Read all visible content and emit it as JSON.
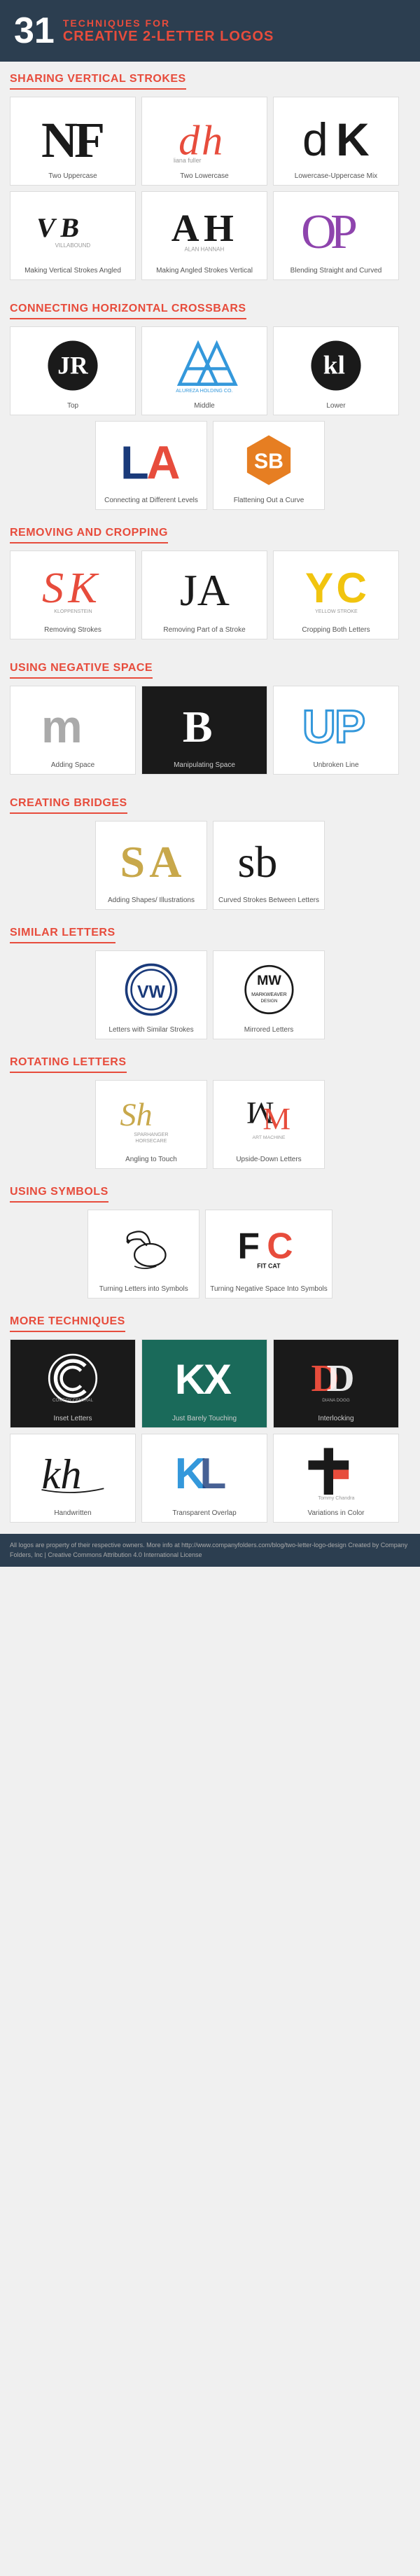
{
  "header": {
    "number": "31",
    "line1_plain": "TECHNIQUES FOR",
    "line1_highlight": "TECHNIQUES FOR",
    "line2": "CREATIVE 2-LETTER LOGOS"
  },
  "sections": [
    {
      "id": "sharing-vertical-strokes",
      "title": "Sharing Vertical Strokes",
      "rows": [
        [
          {
            "label": "Two Uppercase"
          },
          {
            "label": "Two Lowercase"
          },
          {
            "label": "Lowercase-Uppercase Mix"
          }
        ],
        [
          {
            "label": "Making Vertical Strokes Angled"
          },
          {
            "label": "Making Angled Strokes Vertical"
          },
          {
            "label": "Blending Straight and Curved"
          }
        ]
      ]
    },
    {
      "id": "connecting-horizontal-crossbars",
      "title": "Connecting Horizontal Crossbars",
      "rows": [
        [
          {
            "label": "Top"
          },
          {
            "label": "Middle"
          },
          {
            "label": "Lower"
          }
        ],
        [
          {
            "label": "Connecting at Different Levels"
          },
          {
            "label": "Flattening Out a Curve"
          }
        ]
      ]
    },
    {
      "id": "removing-and-cropping",
      "title": "Removing and Cropping",
      "rows": [
        [
          {
            "label": "Removing Strokes"
          },
          {
            "label": "Removing Part of a Stroke"
          },
          {
            "label": "Cropping Both Letters"
          }
        ]
      ]
    },
    {
      "id": "using-negative-space",
      "title": "Using Negative Space",
      "rows": [
        [
          {
            "label": "Adding Space"
          },
          {
            "label": "Manipulating Space"
          },
          {
            "label": "Unbroken Line"
          }
        ]
      ]
    },
    {
      "id": "creating-bridges",
      "title": "Creating Bridges",
      "rows": [
        [
          {
            "label": "Adding Shapes/ Illustrations"
          },
          {
            "label": "Curved Strokes Between Letters"
          }
        ]
      ]
    },
    {
      "id": "similar-letters",
      "title": "Similar Letters",
      "rows": [
        [
          {
            "label": "Letters with Similar Strokes"
          },
          {
            "label": "Mirrored Letters"
          }
        ]
      ]
    },
    {
      "id": "rotating-letters",
      "title": "Rotating Letters",
      "rows": [
        [
          {
            "label": "Angling to Touch"
          },
          {
            "label": "Upside-Down Letters"
          }
        ]
      ]
    },
    {
      "id": "using-symbols",
      "title": "Using Symbols",
      "rows": [
        [
          {
            "label": "Turning Letters into Symbols"
          },
          {
            "label": "Turning Negative Space\nInto Symbols"
          }
        ]
      ]
    },
    {
      "id": "more-techniques",
      "title": "More Techniques",
      "rows": [
        [
          {
            "label": "Inset Letters"
          },
          {
            "label": "Just Barely Touching"
          },
          {
            "label": "Interlocking"
          }
        ],
        [
          {
            "label": "Handwritten"
          },
          {
            "label": "Transparent Overlap"
          },
          {
            "label": "Variations in Color"
          }
        ]
      ]
    }
  ],
  "footer": {
    "text": "All logos are property of their respective owners. More info at http://www.companyfolders.com/blog/two-letter-logo-design\nCreated by Company Folders, Inc | Creative Commons Attribution 4.0 International License"
  }
}
